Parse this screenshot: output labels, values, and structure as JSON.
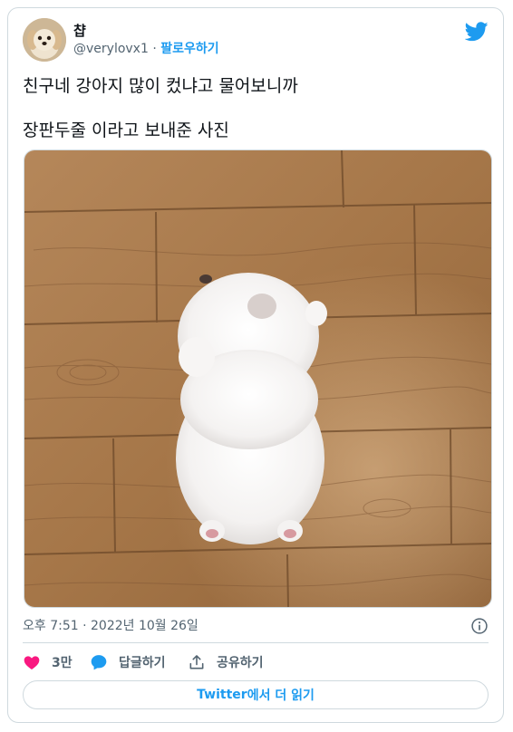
{
  "author": {
    "display_name": "챱",
    "handle": "@verylovx1",
    "separator": " · ",
    "follow_label": "팔로우하기"
  },
  "tweet": {
    "lines": [
      "친구네 강아지 많이 컸냐고 물어보니까",
      "장판두줄 이라고 보내준 사진"
    ],
    "timestamp": "오후 7:51 · 2022년 10월 26일"
  },
  "actions": {
    "like_count": "3만",
    "reply_label": "답글하기",
    "share_label": "공유하기"
  },
  "read_more": {
    "brand": "Twitter",
    "suffix": "에서 더 읽기"
  },
  "icons": {
    "logo": "twitter-bird-icon",
    "info": "info-circle-icon",
    "like": "heart-icon",
    "reply": "speech-bubble-icon",
    "share": "share-upload-icon"
  },
  "colors": {
    "brand_blue": "#1d9bf0",
    "like_pink": "#f91880",
    "text_primary": "#0f1419",
    "text_secondary": "#536471",
    "border": "#cfd9de"
  }
}
